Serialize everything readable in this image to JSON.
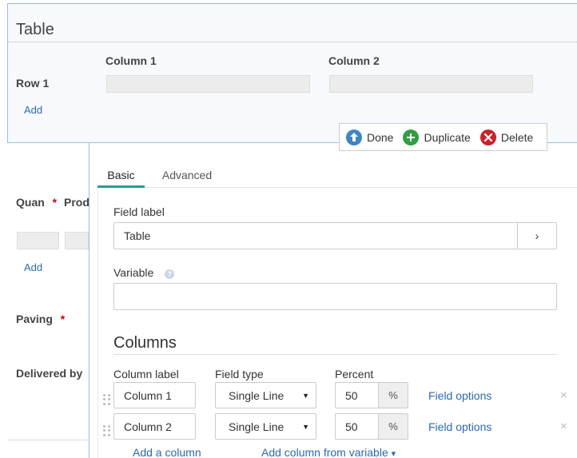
{
  "form": {
    "title": "Table",
    "columns": [
      "Column 1",
      "Column 2"
    ],
    "rows": [
      {
        "label": "Row 1"
      }
    ],
    "add_label": "Add",
    "fields": [
      {
        "label": "Quan",
        "required": "*"
      },
      {
        "label": "Prod"
      },
      {
        "label": "Paving",
        "required": "*"
      },
      {
        "label": "Delivered by"
      }
    ],
    "add_label_2": "Add"
  },
  "actions": {
    "done": "Done",
    "duplicate": "Duplicate",
    "delete": "Delete"
  },
  "tabs": [
    {
      "label": "Basic",
      "active": true
    },
    {
      "label": "Advanced",
      "active": false
    }
  ],
  "basic": {
    "field_label_title": "Field label",
    "field_label_value": "Table",
    "field_label_arrow": "›",
    "variable_title": "Variable",
    "variable_help": "?",
    "variable_value": "",
    "columns_section": "Columns",
    "headers": {
      "column_label": "Column label",
      "field_type": "Field type",
      "percent": "Percent"
    },
    "column_rows": [
      {
        "label": "Column 1",
        "type": "Single Line",
        "percent": "50",
        "unit": "%",
        "options_link": "Field options",
        "remove": "×"
      },
      {
        "label": "Column 2",
        "type": "Single Line",
        "percent": "50",
        "unit": "%",
        "options_link": "Field options",
        "remove": "×"
      }
    ],
    "add_column": "Add a column",
    "add_from_variable": "Add column from variable",
    "add_from_variable_caret": "▾",
    "select_caret": "▼"
  },
  "colors": {
    "frame_border": "#9dbbe6",
    "link": "#2a6ab0",
    "tab_active": "#2a9d8f",
    "done": "#3d85c6",
    "duplicate": "#2e9e3f",
    "delete": "#c8232c",
    "required": "#cc0000"
  }
}
